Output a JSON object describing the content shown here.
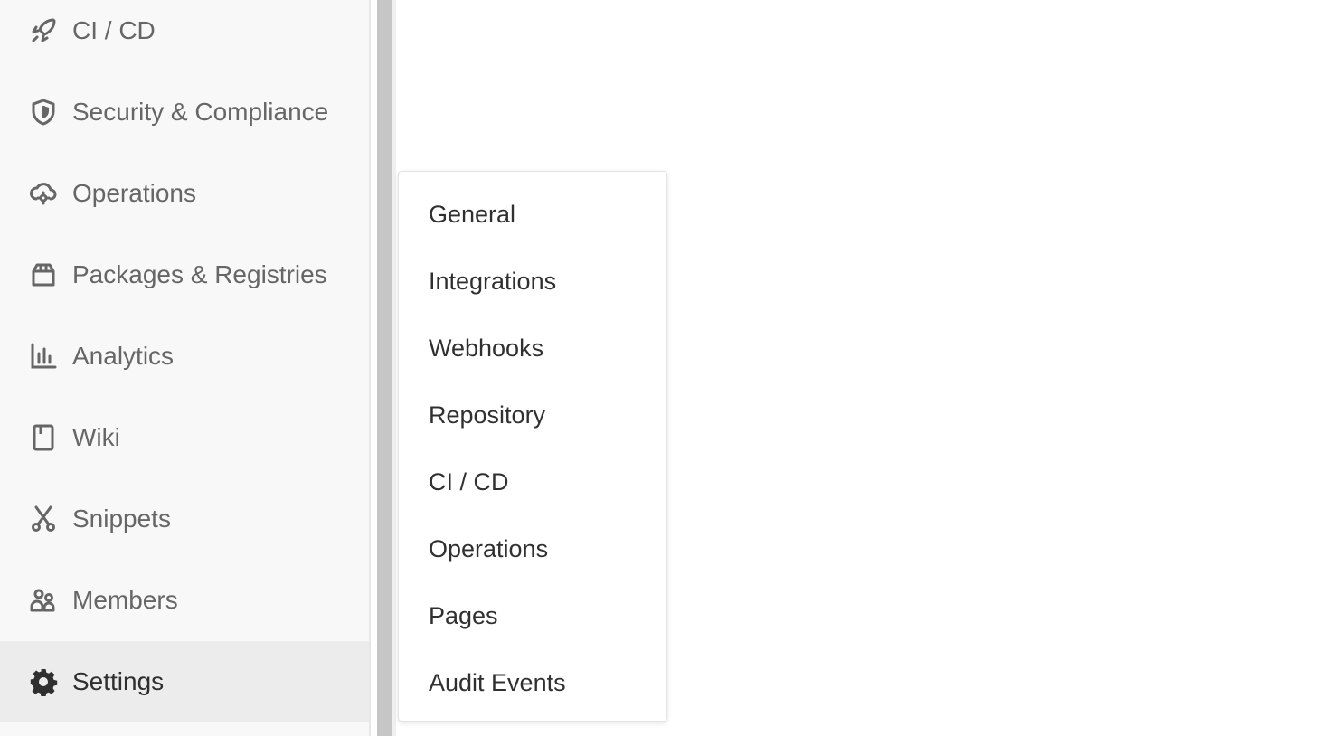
{
  "sidebar": {
    "items": [
      {
        "label": "CI / CD",
        "icon": "rocket-icon"
      },
      {
        "label": "Security & Compliance",
        "icon": "shield-icon"
      },
      {
        "label": "Operations",
        "icon": "cloud-gear-icon"
      },
      {
        "label": "Packages & Registries",
        "icon": "package-icon"
      },
      {
        "label": "Analytics",
        "icon": "chart-icon"
      },
      {
        "label": "Wiki",
        "icon": "book-icon"
      },
      {
        "label": "Snippets",
        "icon": "scissors-icon"
      },
      {
        "label": "Members",
        "icon": "users-icon"
      },
      {
        "label": "Settings",
        "icon": "gear-icon",
        "active": true
      }
    ]
  },
  "settings_flyout": {
    "items": [
      {
        "label": "General"
      },
      {
        "label": "Integrations"
      },
      {
        "label": "Webhooks"
      },
      {
        "label": "Repository"
      },
      {
        "label": "CI / CD"
      },
      {
        "label": "Operations"
      },
      {
        "label": "Pages"
      },
      {
        "label": "Audit Events"
      }
    ]
  },
  "colors": {
    "sidebar_bg": "#f8f8f8",
    "active_bg": "#ececec",
    "text_muted": "#666666",
    "text_dark": "#303030"
  }
}
